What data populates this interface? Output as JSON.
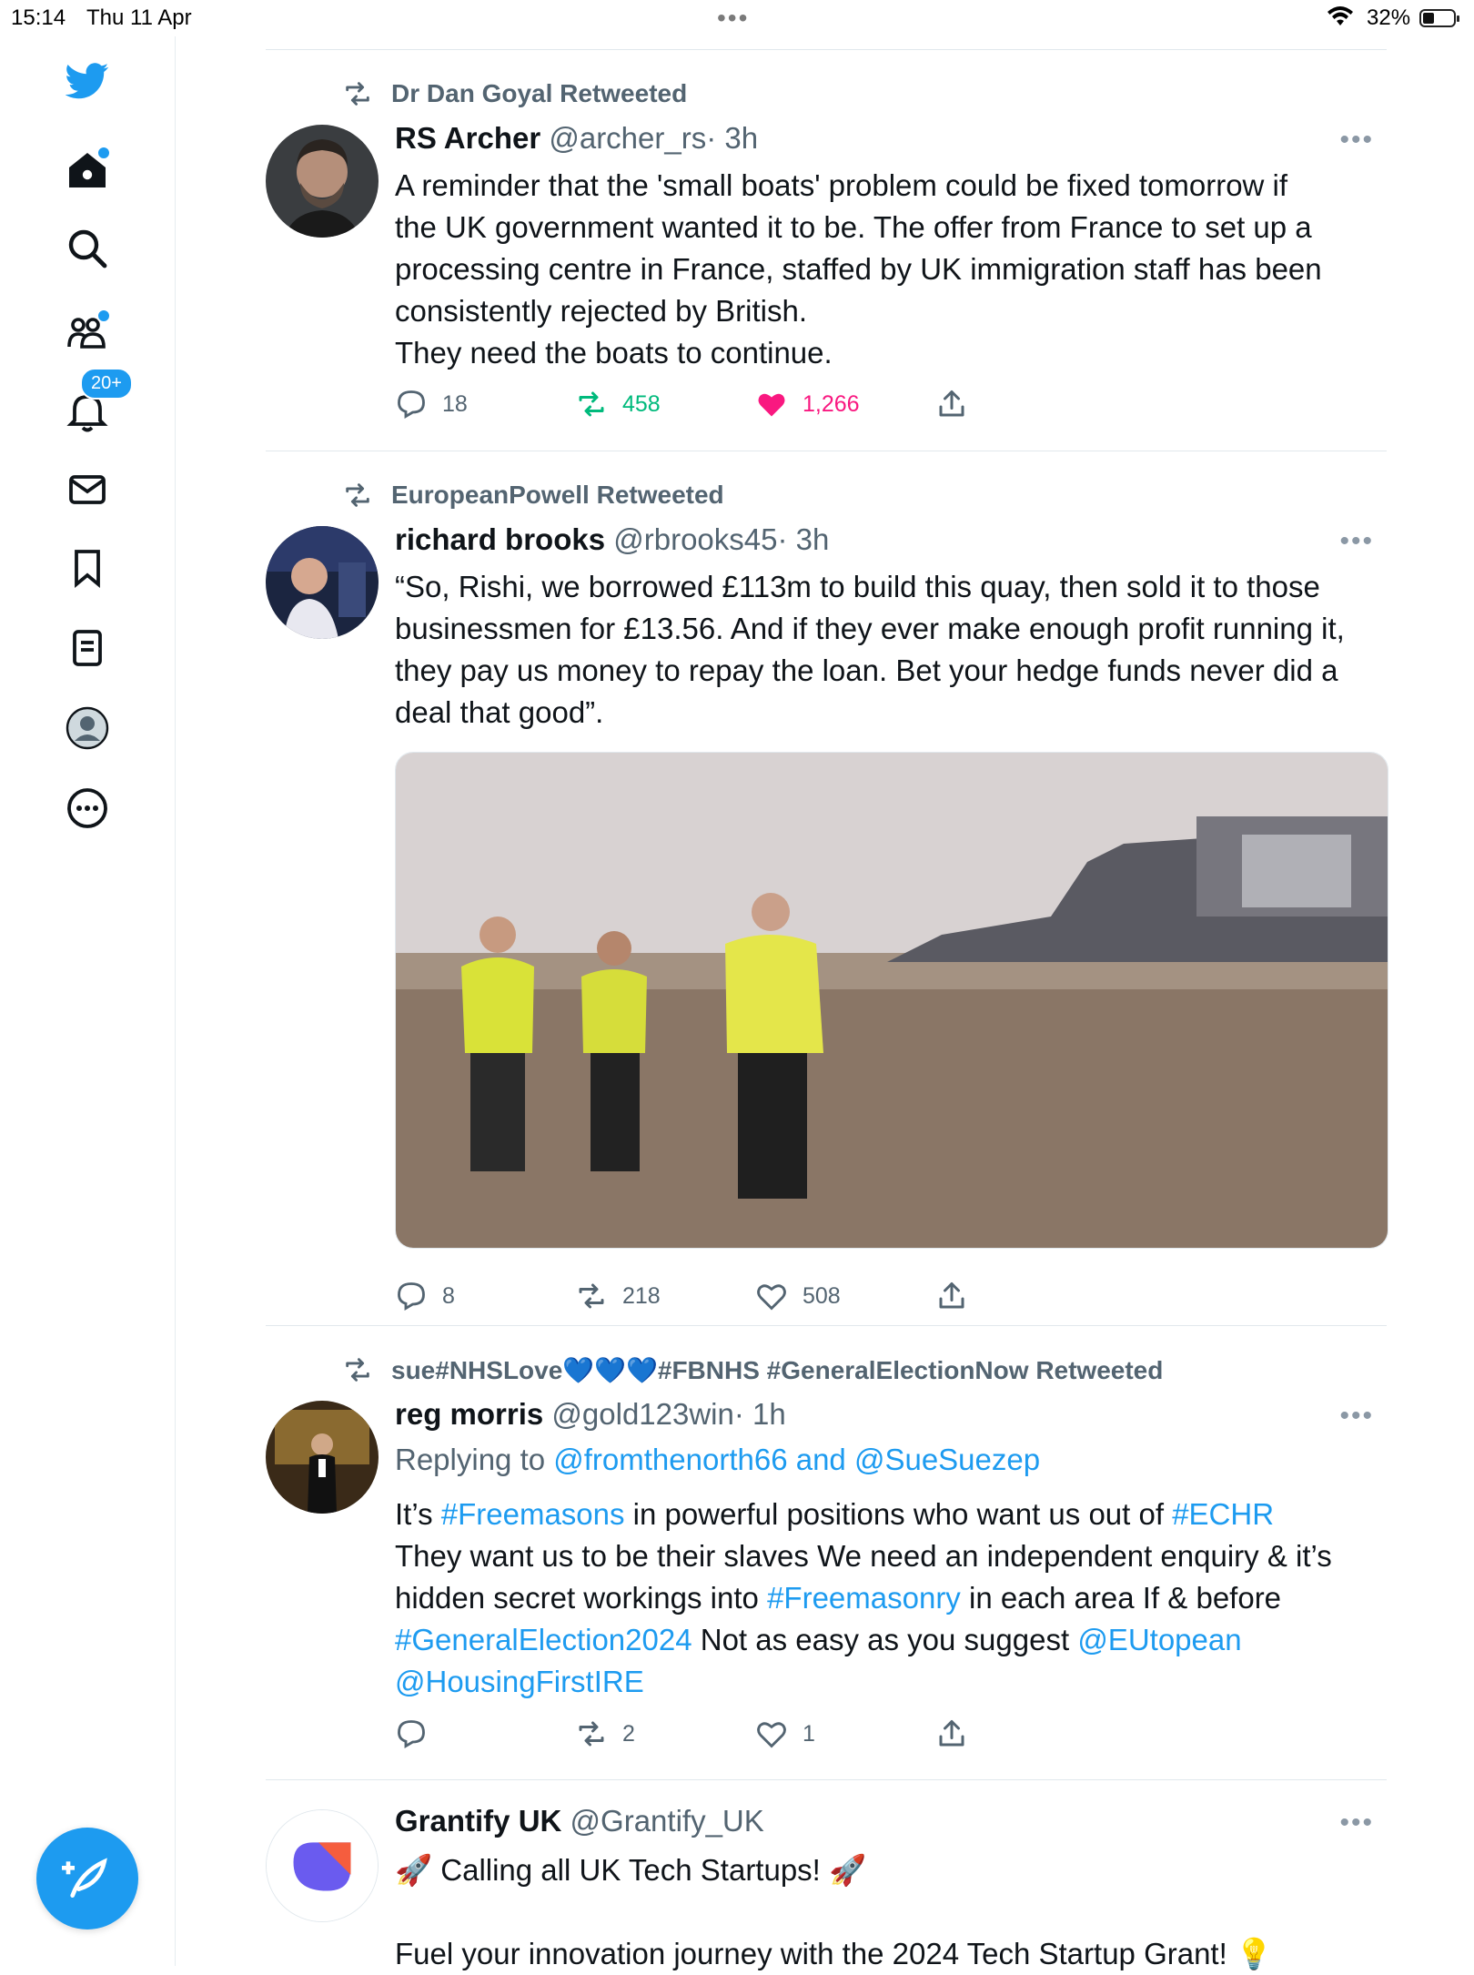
{
  "status_bar": {
    "time": "15:14",
    "date": "Thu 11 Apr",
    "battery": "32%"
  },
  "sidebar": {
    "notifications_badge": "20+"
  },
  "colors": {
    "accent": "#1d9bf0",
    "retweet_green": "#00ba7c",
    "like_pink": "#f91880",
    "secondary_text": "#536471"
  },
  "tweets": [
    {
      "retweeted_by": "Dr Dan Goyal Retweeted",
      "name": "RS Archer",
      "handle": "@archer_rs",
      "time": "· 3h",
      "text_lines": [
        "A reminder that the 'small boats' problem could be fixed tomorrow if",
        "the UK government wanted it to be.  The offer from France to set up a",
        "processing centre in France, staffed by UK immigration staff has been",
        "consistently rejected by British.",
        "They need the boats to continue."
      ],
      "replies": "18",
      "retweets": "458",
      "likes": "1,266"
    },
    {
      "retweeted_by": "EuropeanPowell Retweeted",
      "name": "richard brooks",
      "handle": "@rbrooks45",
      "time": "· 3h",
      "text_lines": [
        "“So, Rishi, we borrowed £113m to build this quay, then sold it to those",
        "businessmen for £13.56. And if they ever make enough profit running it,",
        "they pay us money to repay the loan. Bet your hedge funds never did a",
        "deal that good”."
      ],
      "replies": "8",
      "retweets": "218",
      "likes": "508"
    },
    {
      "retweeted_by": "sue#NHSLove💙💙💙#FBNHS #GeneralElectionNow Retweeted",
      "name": "reg morris",
      "handle": "@gold123win",
      "time": "· 1h",
      "replying_prefix": "Replying to ",
      "replying_to": "@fromthenorth66 and @SueSuezep",
      "text": {
        "l1_a": "It’s ",
        "l1_b": "#Freemasons",
        "l1_c": " in powerful positions  who want us out of ",
        "l1_d": "#ECHR",
        "l2": "They want us to be their slaves  We need an independent enquiry & it’s",
        "l3_a": "hidden secret workings into ",
        "l3_b": "#Freemasonry",
        "l3_c": " in each area If & before",
        "l4_a": "#GeneralElection2024",
        "l4_b": " Not as easy as you suggest ",
        "l4_c": "@EUtopean",
        "l5": "@HousingFirstIRE"
      },
      "replies": "",
      "retweets": "2",
      "likes": "1"
    },
    {
      "name": "Grantify UK",
      "handle": "@Grantify_UK",
      "line1": "🚀 Calling all UK Tech Startups! 🚀",
      "line2": "Fuel your innovation journey with the 2024 Tech Startup Grant! 💡"
    }
  ]
}
